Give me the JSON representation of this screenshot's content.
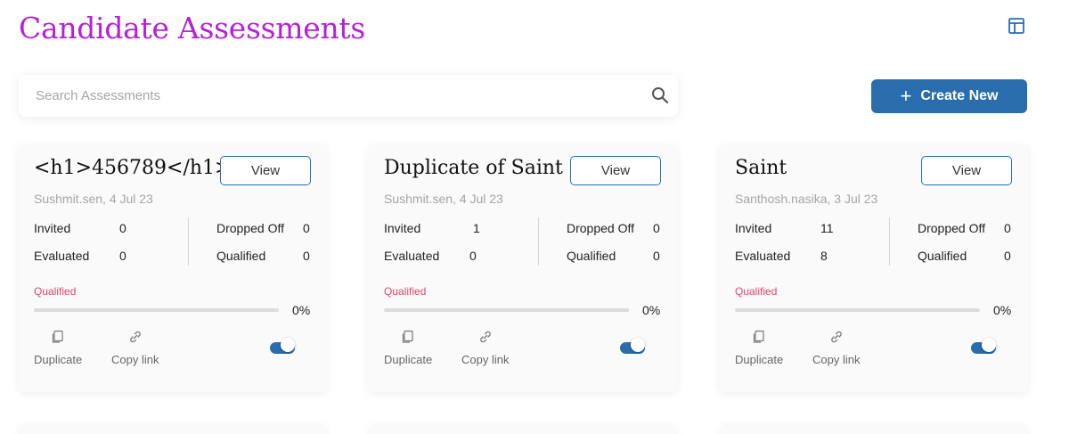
{
  "header": {
    "title": "Candidate Assessments",
    "layout_icon": "layout-grid-icon"
  },
  "search": {
    "placeholder": "Search Assessments",
    "value": "",
    "icon": "search-icon"
  },
  "create_button": {
    "label": "Create New",
    "icon": "plus-icon"
  },
  "colors": {
    "title": "#b521d6",
    "primary": "#2a6dac",
    "qualified_label": "#e0466b",
    "muted": "#a5a5a5"
  },
  "labels": {
    "invited": "Invited",
    "evaluated": "Evaluated",
    "dropped_off": "Dropped Off",
    "qualified": "Qualified",
    "qualified_progress": "Qualified",
    "view": "View",
    "duplicate": "Duplicate",
    "copy_link": "Copy link"
  },
  "cards": [
    {
      "title": "<h1>456789</h1>",
      "meta": "Sushmit.sen, 4 Jul 23",
      "invited": "0",
      "evaluated": "0",
      "dropped_off": "0",
      "qualified": "0",
      "qualified_pct_label": "0%",
      "qualified_pct": 0,
      "toggle_on": true
    },
    {
      "title": "Duplicate of Saint",
      "meta": "Sushmit.sen, 4 Jul 23",
      "invited": "1",
      "evaluated": "0",
      "dropped_off": "0",
      "qualified": "0",
      "qualified_pct_label": "0%",
      "qualified_pct": 0,
      "toggle_on": true
    },
    {
      "title": "Saint",
      "meta": "Santhosh.nasika, 3 Jul 23",
      "invited": "11",
      "evaluated": "8",
      "dropped_off": "0",
      "qualified": "0",
      "qualified_pct_label": "0%",
      "qualified_pct": 0,
      "toggle_on": true
    }
  ]
}
